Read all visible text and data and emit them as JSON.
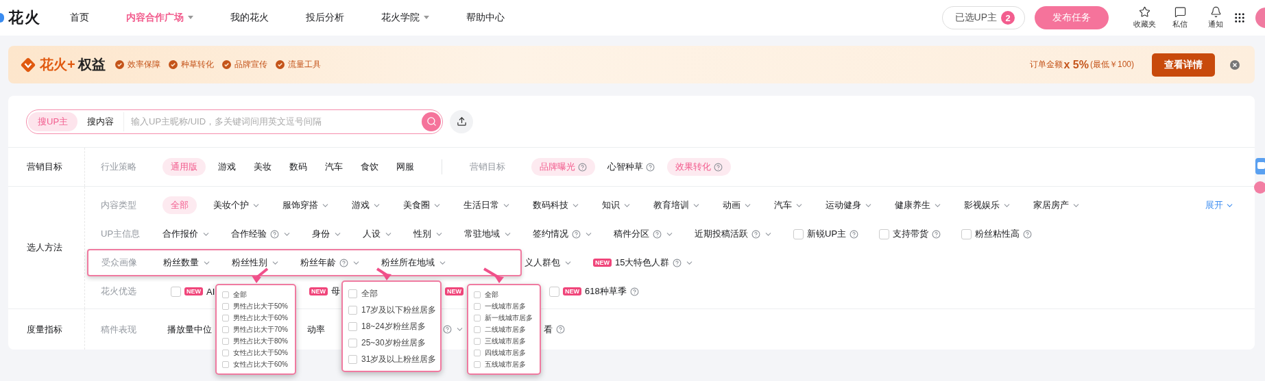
{
  "nav": {
    "logo": "花火",
    "items": [
      {
        "label": "首页",
        "selected": false,
        "dropdown": false
      },
      {
        "label": "内容合作广场",
        "selected": true,
        "dropdown": true
      },
      {
        "label": "我的花火",
        "selected": false,
        "dropdown": false
      },
      {
        "label": "投后分析",
        "selected": false,
        "dropdown": false
      },
      {
        "label": "花火学院",
        "selected": false,
        "dropdown": true
      },
      {
        "label": "帮助中心",
        "selected": false,
        "dropdown": false
      }
    ],
    "picked": {
      "label": "已选UP主",
      "count": "2"
    },
    "publish": "发布任务",
    "actions": [
      {
        "kind": "star",
        "label": "收藏夹"
      },
      {
        "kind": "message",
        "label": "私信"
      },
      {
        "kind": "bell",
        "label": "通知"
      },
      {
        "kind": "apps"
      }
    ]
  },
  "banner": {
    "brand": "花火+",
    "title": "权益",
    "features": [
      "效率保障",
      "种草转化",
      "品牌宣传",
      "流量工具"
    ],
    "offer_prefix": "订单金额",
    "offer_rate": "x 5%",
    "offer_note": "(最低￥100)",
    "button": "查看详情"
  },
  "search": {
    "tabs": [
      {
        "label": "搜UP主",
        "selected": true
      },
      {
        "label": "搜内容",
        "selected": false
      }
    ],
    "placeholder": "输入UP主昵称/UID，多关键词间用英文逗号间隔"
  },
  "sections": [
    {
      "label": "营销目标",
      "rows": [
        {
          "segments": [
            {
              "label": "行业策略",
              "items": [
                {
                  "kind": "option",
                  "label": "通用版",
                  "selected": true
                },
                {
                  "kind": "option",
                  "label": "游戏",
                  "selected": false
                },
                {
                  "kind": "option",
                  "label": "美妆",
                  "selected": false
                },
                {
                  "kind": "option",
                  "label": "数码",
                  "selected": false
                },
                {
                  "kind": "option",
                  "label": "汽车",
                  "selected": false
                },
                {
                  "kind": "option",
                  "label": "食饮",
                  "selected": false
                },
                {
                  "kind": "option",
                  "label": "网服",
                  "selected": false
                }
              ]
            },
            {
              "label": "营销目标",
              "items": [
                {
                  "kind": "option",
                  "label": "品牌曝光",
                  "selected": true,
                  "help": true
                },
                {
                  "kind": "option",
                  "label": "心智种草",
                  "selected": false,
                  "help": true
                },
                {
                  "kind": "option",
                  "label": "效果转化",
                  "selected": true,
                  "help": true
                }
              ]
            }
          ]
        }
      ]
    },
    {
      "label": "选人方法",
      "rows": [
        {
          "more": "展开",
          "segments": [
            {
              "label": "内容类型",
              "items": [
                {
                  "kind": "option",
                  "label": "全部",
                  "selected": true
                },
                {
                  "kind": "option",
                  "label": "美妆个护",
                  "selected": false,
                  "dropdown": true
                },
                {
                  "kind": "option",
                  "label": "服饰穿搭",
                  "selected": false,
                  "dropdown": true
                },
                {
                  "kind": "option",
                  "label": "游戏",
                  "selected": false,
                  "dropdown": true
                },
                {
                  "kind": "option",
                  "label": "美食圈",
                  "selected": false,
                  "dropdown": true
                },
                {
                  "kind": "option",
                  "label": "生活日常",
                  "selected": false,
                  "dropdown": true
                },
                {
                  "kind": "option",
                  "label": "数码科技",
                  "selected": false,
                  "dropdown": true
                },
                {
                  "kind": "option",
                  "label": "知识",
                  "selected": false,
                  "dropdown": true
                },
                {
                  "kind": "option",
                  "label": "教育培训",
                  "selected": false,
                  "dropdown": true
                },
                {
                  "kind": "option",
                  "label": "动画",
                  "selected": false,
                  "dropdown": true
                },
                {
                  "kind": "option",
                  "label": "汽车",
                  "selected": false,
                  "dropdown": true
                },
                {
                  "kind": "option",
                  "label": "运动健身",
                  "selected": false,
                  "dropdown": true
                },
                {
                  "kind": "option",
                  "label": "健康养生",
                  "selected": false,
                  "dropdown": true
                },
                {
                  "kind": "option",
                  "label": "影视娱乐",
                  "selected": false,
                  "dropdown": true
                },
                {
                  "kind": "option",
                  "label": "家居房产",
                  "selected": false,
                  "dropdown": true
                }
              ]
            }
          ]
        },
        {
          "segments": [
            {
              "label": "UP主信息",
              "items": [
                {
                  "kind": "filter",
                  "label": "合作报价",
                  "dropdown": true
                },
                {
                  "kind": "filter",
                  "label": "合作经验",
                  "help": true,
                  "dropdown": true
                },
                {
                  "kind": "filter",
                  "label": "身份",
                  "dropdown": true
                },
                {
                  "kind": "filter",
                  "label": "人设",
                  "dropdown": true
                },
                {
                  "kind": "filter",
                  "label": "性别",
                  "dropdown": true
                },
                {
                  "kind": "filter",
                  "label": "常驻地域",
                  "dropdown": true
                },
                {
                  "kind": "filter",
                  "label": "签约情况",
                  "help": true,
                  "dropdown": true
                },
                {
                  "kind": "filter",
                  "label": "稿件分区",
                  "help": true,
                  "dropdown": true
                },
                {
                  "kind": "filter",
                  "label": "近期投稿活跃",
                  "help": true,
                  "dropdown": true
                },
                {
                  "kind": "filter",
                  "label": "新锐UP主",
                  "checked": false,
                  "help": true
                },
                {
                  "kind": "filter",
                  "label": "支持带货",
                  "checked": false,
                  "help": true
                },
                {
                  "kind": "filter",
                  "label": "粉丝粘性高",
                  "checked": false,
                  "help": true
                }
              ]
            }
          ]
        },
        {
          "segments": [
            {
              "label": "受众画像",
              "highlighted": true,
              "items": [
                {
                  "kind": "filter",
                  "label": "粉丝数量",
                  "dropdown": true
                },
                {
                  "kind": "filter",
                  "label": "粉丝性别",
                  "dropdown": true
                },
                {
                  "kind": "filter",
                  "label": "粉丝年龄",
                  "help": true,
                  "dropdown": true
                },
                {
                  "kind": "filter",
                  "label": "粉丝所在地域",
                  "dropdown": true
                }
              ]
            },
            {
              "items": [
                {
                  "kind": "filter",
                  "label": "义人群包",
                  "dropdown": true
                },
                {
                  "kind": "filter",
                  "badge": "NEW",
                  "label": "15大特色人群",
                  "help": true,
                  "dropdown": true
                }
              ]
            }
          ]
        },
        {
          "segments": [
            {
              "label": "花火优选",
              "items": [
                {
                  "kind": "filter",
                  "checked": false,
                  "badge": "NEW",
                  "label": "AI"
                },
                {
                  "kind": "filter",
                  "badge": "NEW",
                  "label": "母"
                },
                {
                  "kind": "filter",
                  "badge": "NEW"
                },
                {
                  "kind": "filter",
                  "checked": false,
                  "badge": "NEW",
                  "label": "618种草季",
                  "help": true
                }
              ]
            }
          ]
        }
      ]
    },
    {
      "label": "度量指标",
      "rows": [
        {
          "segments": [
            {
              "label": "稿件表现",
              "items": [
                {
                  "kind": "filter",
                  "label": "播放量中位"
                },
                {
                  "kind": "filter",
                  "label": "动率"
                },
                {
                  "kind": "filter",
                  "help": true,
                  "dropdown": true
                },
                {
                  "kind": "filter",
                  "label": "看",
                  "help": true
                }
              ]
            }
          ]
        }
      ]
    }
  ],
  "callouts": [
    {
      "items": [
        {
          "label": "全部",
          "checked": false
        },
        {
          "label": "男性占比大于50%",
          "checked": false
        },
        {
          "label": "男性占比大于60%",
          "checked": false
        },
        {
          "label": "男性占比大于70%",
          "checked": false
        },
        {
          "label": "男性占比大于80%",
          "checked": false
        },
        {
          "label": "女性占比大于50%",
          "checked": false
        },
        {
          "label": "女性占比大于60%",
          "checked": false
        }
      ]
    },
    {
      "items": [
        {
          "label": "全部",
          "checked": false
        },
        {
          "label": "17岁及以下粉丝居多",
          "checked": false
        },
        {
          "label": "18~24岁粉丝居多",
          "checked": false
        },
        {
          "label": "25~30岁粉丝居多",
          "checked": false
        },
        {
          "label": "31岁及以上粉丝居多",
          "checked": false
        }
      ]
    },
    {
      "items": [
        {
          "label": "全部",
          "checked": false
        },
        {
          "label": "一线城市居多",
          "checked": false
        },
        {
          "label": "新一线城市居多",
          "checked": false
        },
        {
          "label": "二线城市居多",
          "checked": false
        },
        {
          "label": "三线城市居多",
          "checked": false
        },
        {
          "label": "四线城市居多",
          "checked": false
        },
        {
          "label": "五线城市居多",
          "checked": false
        }
      ]
    }
  ]
}
